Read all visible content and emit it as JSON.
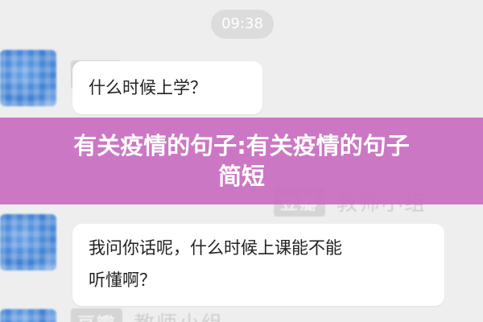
{
  "status": {
    "time": "09:38"
  },
  "watermark": {
    "logo": "豆瓣",
    "group_name": "教师小组"
  },
  "messages": [
    {
      "text": "什么时候上学？"
    },
    {
      "line1": "我问你话呢，什么时候上课能不能",
      "line2": "听懂啊？"
    }
  ],
  "banner": {
    "line1": "有关疫情的句子:有关疫情的句子",
    "line2": "简短",
    "color": "#c96cc0"
  }
}
